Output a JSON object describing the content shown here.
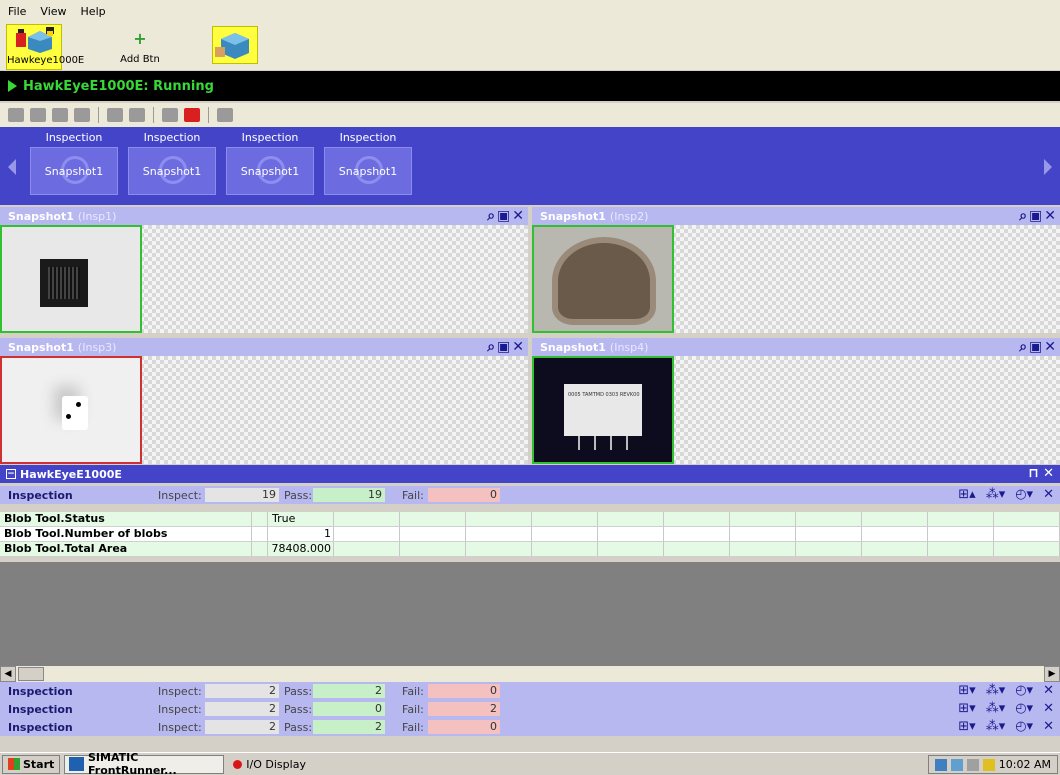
{
  "menu": [
    {
      "label": "File"
    },
    {
      "label": "View"
    },
    {
      "label": "Help"
    }
  ],
  "devices": [
    {
      "label": "Hawkeye1000E"
    },
    {
      "label": "Add Btn"
    }
  ],
  "status": {
    "text": "HawkEyeE1000E: Running"
  },
  "inspections_strip": [
    {
      "title": "Inspection",
      "snapshot": "Snapshot1"
    },
    {
      "title": "Inspection",
      "snapshot": "Snapshot1"
    },
    {
      "title": "Inspection",
      "snapshot": "Snapshot1"
    },
    {
      "title": "Inspection",
      "snapshot": "Snapshot1"
    }
  ],
  "panes": [
    {
      "title": "Snapshot1",
      "sub": "(Insp1)",
      "result": "pass"
    },
    {
      "title": "Snapshot1",
      "sub": "(Insp2)",
      "result": "pass"
    },
    {
      "title": "Snapshot1",
      "sub": "(Insp3)",
      "result": "fail"
    },
    {
      "title": "Snapshot1",
      "sub": "(Insp4)",
      "result": "pass"
    }
  ],
  "image_text": "0005 TAMTMD 0303 REVK00",
  "group": {
    "title": "HawkEyeE1000E"
  },
  "results": [
    {
      "name": "Inspection",
      "inspect_label": "Inspect:",
      "inspect": "19",
      "pass_label": "Pass:",
      "pass": "19",
      "fail_label": "Fail:",
      "fail": "0"
    },
    {
      "name": "Inspection",
      "inspect_label": "Inspect:",
      "inspect": "2",
      "pass_label": "Pass:",
      "pass": "2",
      "fail_label": "Fail:",
      "fail": "0"
    },
    {
      "name": "Inspection",
      "inspect_label": "Inspect:",
      "inspect": "2",
      "pass_label": "Pass:",
      "pass": "0",
      "fail_label": "Fail:",
      "fail": "2"
    },
    {
      "name": "Inspection",
      "inspect_label": "Inspect:",
      "inspect": "2",
      "pass_label": "Pass:",
      "pass": "2",
      "fail_label": "Fail:",
      "fail": "0"
    }
  ],
  "table": {
    "rows": [
      {
        "name": "Blob Tool.Status",
        "value": "True",
        "align": "left"
      },
      {
        "name": "Blob Tool.Number of blobs",
        "value": "1",
        "align": "right"
      },
      {
        "name": "Blob Tool.Total Area",
        "value": "78408.000",
        "align": "right"
      }
    ]
  },
  "taskbar": {
    "start": "Start",
    "tasks": [
      "SIMATIC FrontRunner...",
      "I/O Display"
    ],
    "clock": "10:02 AM"
  },
  "colors": {
    "strip_bg": "#4444c8",
    "pane_header": "#b8b8f0",
    "pass_green": "#30c030",
    "fail_red": "#d03030",
    "status_green": "#38d838"
  }
}
